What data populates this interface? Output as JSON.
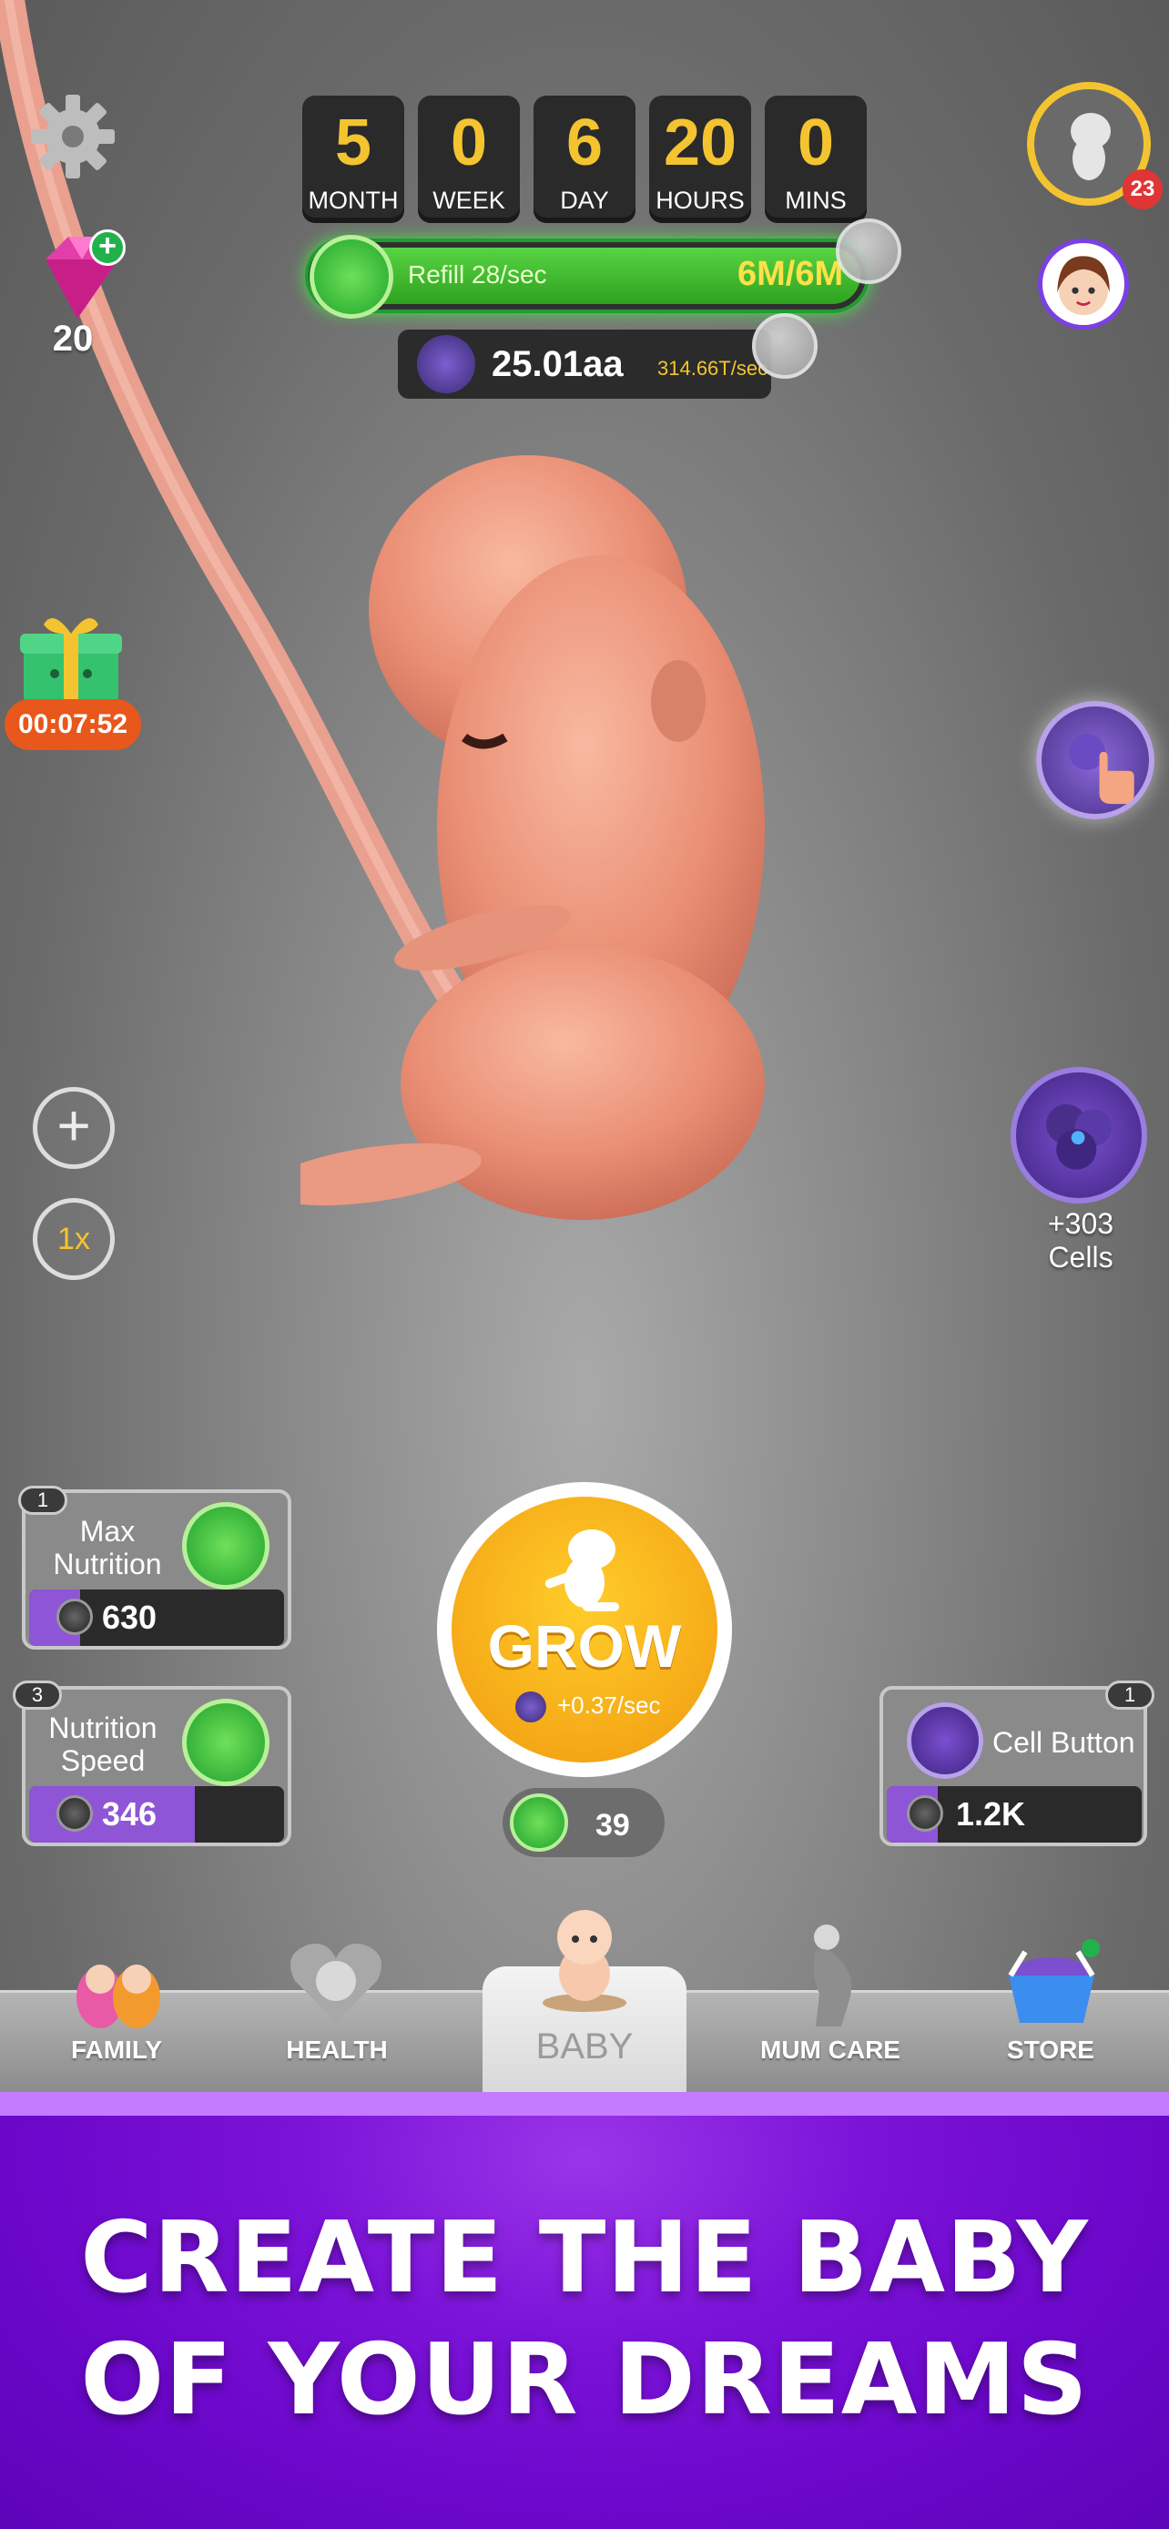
{
  "counters": {
    "gems": "20",
    "time": [
      {
        "value": "5",
        "label": "MONTH"
      },
      {
        "value": "0",
        "label": "WEEK"
      },
      {
        "value": "6",
        "label": "DAY"
      },
      {
        "value": "20",
        "label": "HOURS"
      },
      {
        "value": "0",
        "label": "MINS"
      }
    ],
    "refill": {
      "text": "Refill 28/sec",
      "value": "6M/6M",
      "fill_fraction": 1.0
    },
    "cells": {
      "value": "25.01aa",
      "rate": "314.66T/sec"
    },
    "level_badge": "23"
  },
  "gift": {
    "timer": "00:07:52"
  },
  "side_controls": {
    "plus": "+",
    "speed": "1x"
  },
  "bonus": {
    "label": "+303 Cells"
  },
  "upgrades": [
    {
      "level": "1",
      "title_line1": "Max",
      "title_line2": "Nutrition",
      "cost": "630",
      "fill_fraction": 0.2
    },
    {
      "level": "3",
      "title_line1": "Nutrition",
      "title_line2": "Speed",
      "cost": "346",
      "fill_fraction": 0.65
    },
    {
      "level": "1",
      "title_line1": "Cell Button",
      "title_line2": "",
      "cost": "1.2K",
      "fill_fraction": 0.2
    }
  ],
  "grow": {
    "label": "GROW",
    "rate": "+0.37/sec",
    "baby_count": "39"
  },
  "nav": {
    "family": "FAMILY",
    "health": "HEALTH",
    "baby": "BABY",
    "mum_care": "MUM CARE",
    "store": "STORE"
  },
  "banner": {
    "line1": "CREATE THE BABY",
    "line2": "OF YOUR DREAMS"
  },
  "colors": {
    "accent_gold": "#f4c430",
    "refill_green": "#2fa21f",
    "banner_purple": "#7b12d8",
    "cell_purple": "#8e55d6"
  }
}
